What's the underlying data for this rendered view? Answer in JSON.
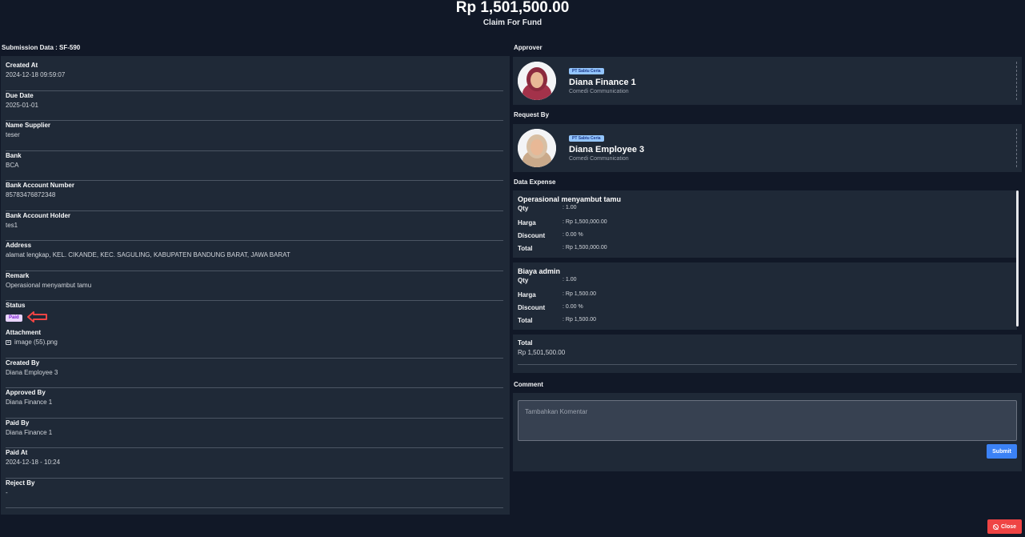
{
  "header": {
    "amount": "Rp 1,501,500.00",
    "subtitle": "Claim For Fund"
  },
  "submission": {
    "title": "Submission Data : SF-590",
    "fields": [
      {
        "label": "Created At",
        "value": "2024-12-18 09:59:07"
      },
      {
        "label": "Due Date",
        "value": "2025-01-01"
      },
      {
        "label": "Name Supplier",
        "value": "teser"
      },
      {
        "label": "Bank",
        "value": "BCA"
      },
      {
        "label": "Bank Account Number",
        "value": "85783476872348"
      },
      {
        "label": "Bank Account Holder",
        "value": "tes1"
      },
      {
        "label": "Address",
        "value": "alamat lengkap, KEL. CIKANDE, KEC. SAGULING, KABUPATEN BANDUNG BARAT, JAWA BARAT"
      },
      {
        "label": "Remark",
        "value": "Operasional menyambut tamu"
      }
    ],
    "status": {
      "label": "Status",
      "value": "Paid",
      "badge_color": "#e9d5ff"
    },
    "attachment": {
      "label": "Attachment",
      "value": "image (55).png"
    },
    "fields_after": [
      {
        "label": "Created By",
        "value": "Diana Employee 3"
      },
      {
        "label": "Approved By",
        "value": "Diana Finance 1"
      },
      {
        "label": "Paid By",
        "value": "Diana Finance 1"
      },
      {
        "label": "Paid At",
        "value": "2024-12-18 - 10:24"
      },
      {
        "label": "Reject By",
        "value": "-"
      }
    ]
  },
  "approver": {
    "section_title": "Approver",
    "company": "PT Sabtu Ceria",
    "name": "Diana Finance 1",
    "dept": "Comedi Communication"
  },
  "requester": {
    "section_title": "Request By",
    "company": "PT Sabtu Ceria",
    "name": "Diana Employee 3",
    "dept": "Comedi Communication"
  },
  "expense": {
    "section_title": "Data Expense",
    "items": [
      {
        "title": "Operasional menyambut tamu",
        "qty_label": "Qty",
        "qty": ": 1.00",
        "harga_label": "Harga",
        "harga": ": Rp 1,500,000.00",
        "discount_label": "Discount",
        "discount": ": 0.00 %",
        "total_label": "Total",
        "total": ": Rp 1,500,000.00"
      },
      {
        "title": "Biaya admin",
        "qty_label": "Qty",
        "qty": ": 1.00",
        "harga_label": "Harga",
        "harga": ": Rp 1,500.00",
        "discount_label": "Discount",
        "discount": ": 0.00 %",
        "total_label": "Total",
        "total": ": Rp 1,500.00"
      }
    ]
  },
  "total": {
    "label": "Total",
    "value": "Rp 1,501,500.00"
  },
  "comment": {
    "section_title": "Comment",
    "placeholder": "Tambahkan Komentar",
    "submit_label": "Submit"
  },
  "close_label": "Close",
  "colors": {
    "background": "#111827",
    "card": "#1f2937",
    "submit": "#3b82f6",
    "close": "#ef4444",
    "arrow": "#ef4444"
  }
}
